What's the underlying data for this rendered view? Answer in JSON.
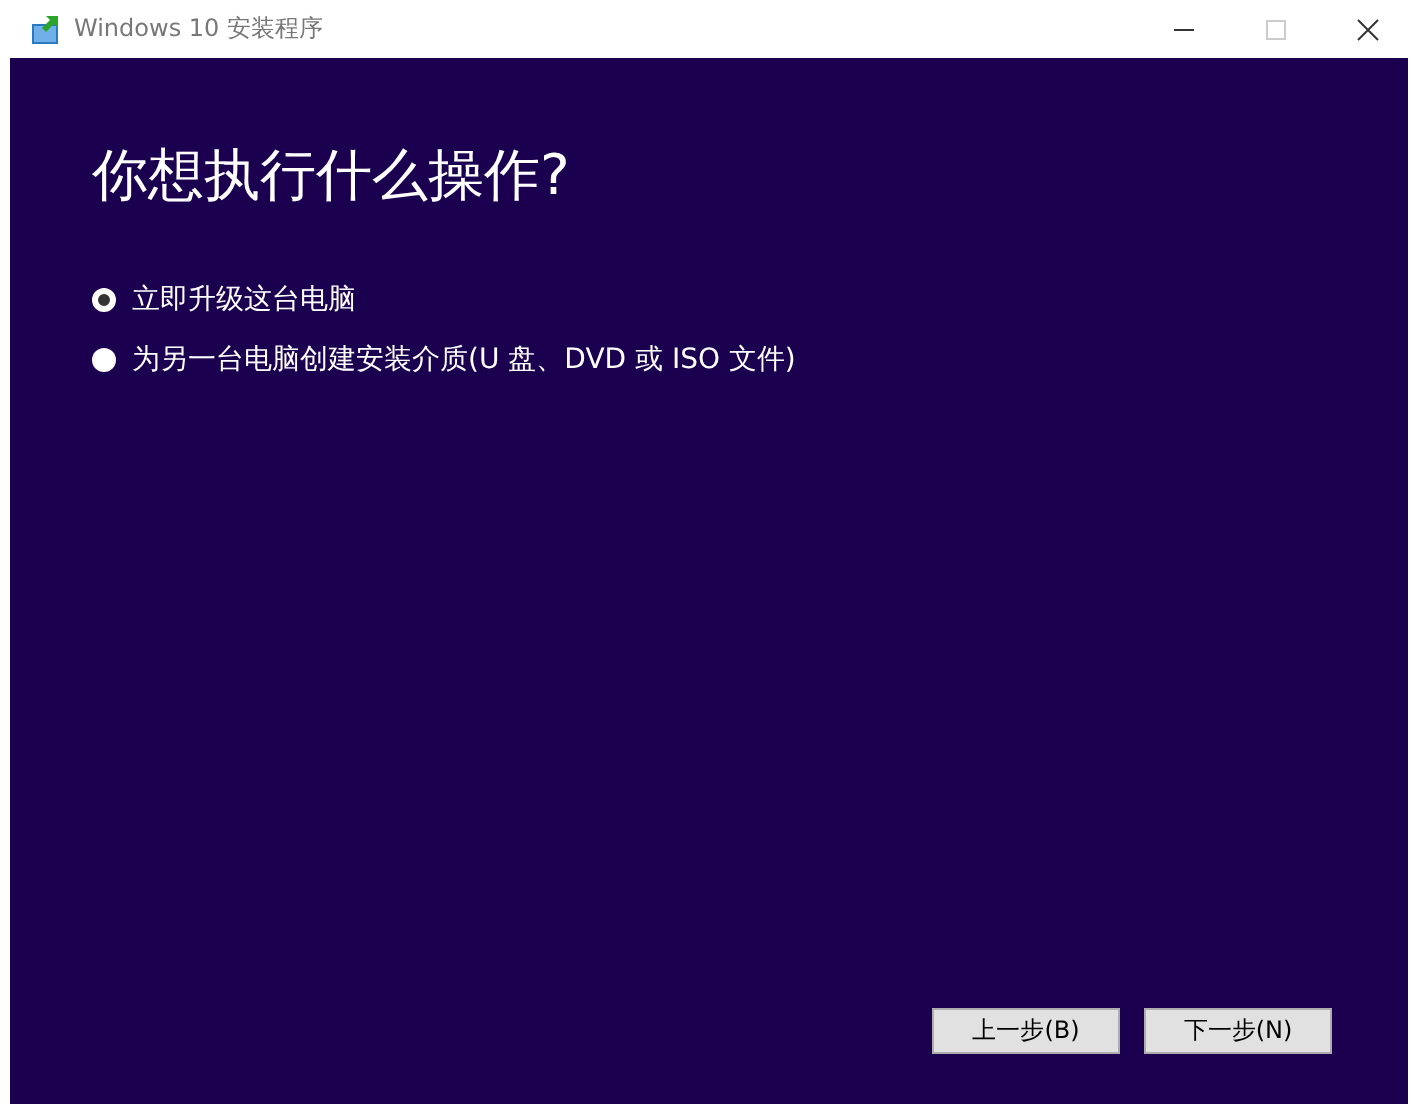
{
  "window": {
    "title": "Windows 10 安装程序"
  },
  "heading": "你想执行什么操作?",
  "options": [
    {
      "label": "立即升级这台电脑",
      "selected": true
    },
    {
      "label": "为另一台电脑创建安装介质(U 盘、DVD 或 ISO 文件)",
      "selected": false
    }
  ],
  "buttons": [
    "上一步(B)",
    "下一步(N)"
  ]
}
